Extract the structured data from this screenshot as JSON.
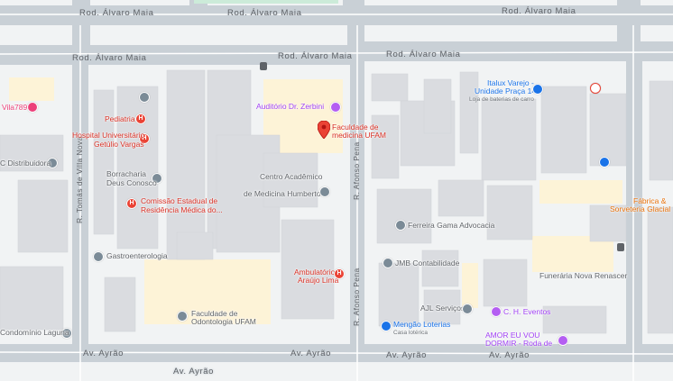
{
  "streets": {
    "alvaro_maia": "Rod. Álvaro Maia",
    "tomas_villa_nova": "R. Tomás de Villa Nova",
    "afonso_pena": "R. Afonso Pena",
    "ayrao": "Av. Ayrão"
  },
  "places": {
    "vila789": "Vila789",
    "pediatria": "Pediatria",
    "hospital_1": "Hospital Universitário",
    "hospital_2": "Getúlio Vargas",
    "c_distribuidora": "C Distribuidora",
    "borracharia_1": "Borracharia",
    "borracharia_2": "Deus Conosco",
    "comissao_1": "Comissão Estadual de",
    "comissao_2": "Residência Médica do...",
    "gastro": "Gastroenterologia",
    "condominio": "Condomínio Laguna",
    "odonto_1": "Faculdade de",
    "odonto_2": "Odontologia UFAM",
    "auditorio": "Auditório Dr. Zerbini",
    "medicina_1": "Faculdade de",
    "medicina_2": "medicina UFAM",
    "centro_1": "Centro Acadêmico",
    "centro_2": "de Medicina Humberto...",
    "ambulatorio_1": "Ambulatório",
    "ambulatorio_2": "Araújo Lima",
    "italux_1": "Italux Varejo -",
    "italux_2": "Unidade Praça 14",
    "italux_sub": "Loja de baterias de carro",
    "ferreira": "Ferreira Gama Advocacia",
    "jmb": "JMB Contabilidade",
    "ajl": "AJL Serviços",
    "ch": "C. H. Eventos",
    "mengao_1": "Mengão Loterias",
    "mengao_sub": "Casa lotérica",
    "funeraria": "Funerária Nova Renascer",
    "amor_1": "AMOR EU VOU",
    "amor_2": "DORMIR - Roda de",
    "fabrica_1": "Fábrica &",
    "fabrica_2": "Sorveteria Glacial"
  },
  "colors": {
    "road": "#c9d0d6",
    "road_edge": "#ffffff",
    "building": "#dadce0",
    "campus": "#fdf3d7",
    "background": "#f1f3f4"
  }
}
